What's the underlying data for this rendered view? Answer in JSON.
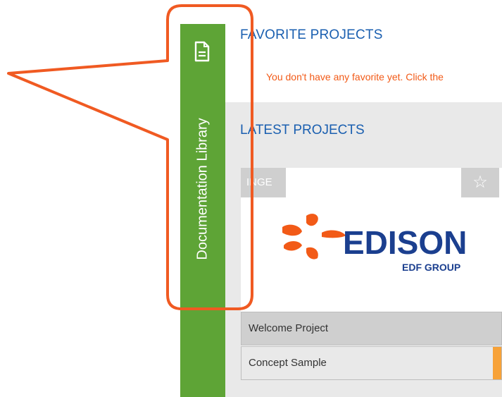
{
  "sidebar": {
    "tab_label": "Documentation Library",
    "icon": "document-icon",
    "color": "#5ea436"
  },
  "favorites": {
    "title": "FAVORITE PROJECTS",
    "empty_message": "You don't have any favorite yet. Click the"
  },
  "latest": {
    "title": "LATEST PROJECTS",
    "card": {
      "tag": "INGE",
      "star_icon": "star-outline-icon",
      "logo": {
        "brand": "EDISON",
        "sub": "EDF GROUP",
        "icon": "edison-logo-icon"
      }
    },
    "projects": [
      {
        "name": "Welcome Project"
      },
      {
        "name": "Concept Sample"
      }
    ]
  },
  "colors": {
    "heading": "#1a5fb0",
    "message": "#f25a17",
    "callout": "#f05a22",
    "accent": "#f7a238"
  }
}
